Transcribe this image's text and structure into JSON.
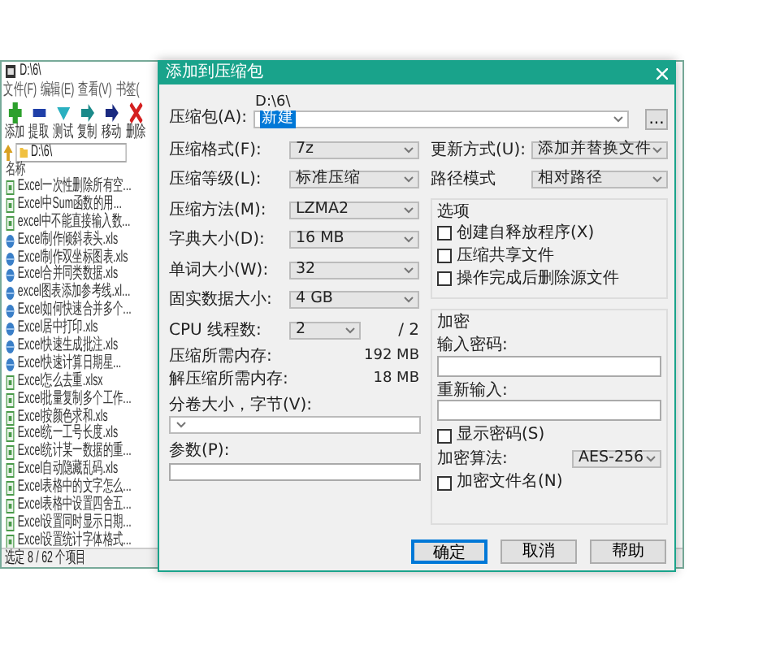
{
  "explorer": {
    "title": "D:\\6\\",
    "menu": [
      "文件(F)",
      "编辑(E)",
      "查看(V)",
      "书签("
    ],
    "toolbar": [
      {
        "label": "添加",
        "kind": "add"
      },
      {
        "label": "提取",
        "kind": "extract"
      },
      {
        "label": "测试",
        "kind": "test"
      },
      {
        "label": "复制",
        "kind": "copy"
      },
      {
        "label": "移动",
        "kind": "move"
      },
      {
        "label": "删除",
        "kind": "delete"
      }
    ],
    "address": "D:\\6\\",
    "column_header": "名称",
    "files": [
      {
        "name": "Excel一次性删除所有空...",
        "kind": "doc"
      },
      {
        "name": "Excel中Sum函数的用...",
        "kind": "doc"
      },
      {
        "name": "excel中不能直接输入数...",
        "kind": "doc"
      },
      {
        "name": "Excel制作倾斜表头.xls",
        "kind": "globe"
      },
      {
        "name": "Excel制作双坐标图表.xls",
        "kind": "globe"
      },
      {
        "name": "Excel合并同类数据.xls",
        "kind": "globe"
      },
      {
        "name": "excel图表添加参考线.xl...",
        "kind": "globe"
      },
      {
        "name": "Excel如何快速合并多个...",
        "kind": "globe"
      },
      {
        "name": "Excel居中打印.xls",
        "kind": "globe"
      },
      {
        "name": "Excel快速生成批注.xls",
        "kind": "globe"
      },
      {
        "name": "Excel快速计算日期星...",
        "kind": "globe"
      },
      {
        "name": "Excel怎么去重.xlsx",
        "kind": "doc"
      },
      {
        "name": "Excel批量复制多个工作...",
        "kind": "doc"
      },
      {
        "name": "Excel按颜色求和.xls",
        "kind": "doc"
      },
      {
        "name": "Excel统一工号长度.xls",
        "kind": "doc"
      },
      {
        "name": "Excel统计某一数据的重...",
        "kind": "doc"
      },
      {
        "name": "Excel自动隐藏乱码.xls",
        "kind": "doc"
      },
      {
        "name": "Excel表格中的文字怎么...",
        "kind": "doc"
      },
      {
        "name": "Excel表格中设置四舍五...",
        "kind": "doc"
      },
      {
        "name": "Excel设置同时显示日期...",
        "kind": "doc"
      },
      {
        "name": "Excel设置统计字体格式...",
        "kind": "doc"
      }
    ],
    "status_bar": "选定 8 / 62 个项目"
  },
  "dialog": {
    "title": "添加到压缩包",
    "archive_label": "压缩包(A):",
    "archive_path": "D:\\6\\",
    "archive_name": "新建",
    "browse": "...",
    "left_fields": [
      {
        "label": "压缩格式(F):",
        "kind": "select",
        "value": "7z"
      },
      {
        "label": "压缩等级(L):",
        "kind": "select",
        "value": "标准压缩"
      },
      {
        "label": "压缩方法(M):",
        "kind": "select",
        "value": "LZMA2"
      },
      {
        "label": "字典大小(D):",
        "kind": "select",
        "value": "16 MB"
      },
      {
        "label": "单词大小(W):",
        "kind": "select",
        "value": "32"
      },
      {
        "label": "固实数据大小:",
        "kind": "select",
        "value": "4 GB"
      },
      {
        "label": "CPU 线程数:",
        "kind": "short_select",
        "value": "2",
        "suffix": "/ 2"
      },
      {
        "label": "压缩所需内存:",
        "kind": "info",
        "value": "192 MB"
      },
      {
        "label": "解压缩所需内存:",
        "kind": "info",
        "value": "18 MB"
      }
    ],
    "volume_label": "分卷大小，字节(V):",
    "params_label": "参数(P):",
    "right_fields": [
      {
        "label": "更新方式(U):",
        "value": "添加并替换文件"
      },
      {
        "label": "路径模式",
        "value": "相对路径"
      }
    ],
    "options": {
      "title": "选项",
      "items": [
        {
          "label": "创建自释放程序(X)",
          "checked": false
        },
        {
          "label": "压缩共享文件",
          "checked": false
        },
        {
          "label": "操作完成后删除源文件",
          "checked": false
        }
      ]
    },
    "encryption": {
      "title": "加密",
      "password_label": "输入密码:",
      "reenter_label": "重新输入:",
      "show_password": {
        "label": "显示密码(S)",
        "checked": false
      },
      "method_label": "加密算法:",
      "method": "AES-256",
      "encrypt_names": {
        "label": "加密文件名(N)",
        "checked": false
      }
    },
    "buttons": [
      {
        "label": "确定",
        "selected": true
      },
      {
        "label": "取消",
        "selected": false
      },
      {
        "label": "帮助",
        "selected": false
      }
    ]
  }
}
